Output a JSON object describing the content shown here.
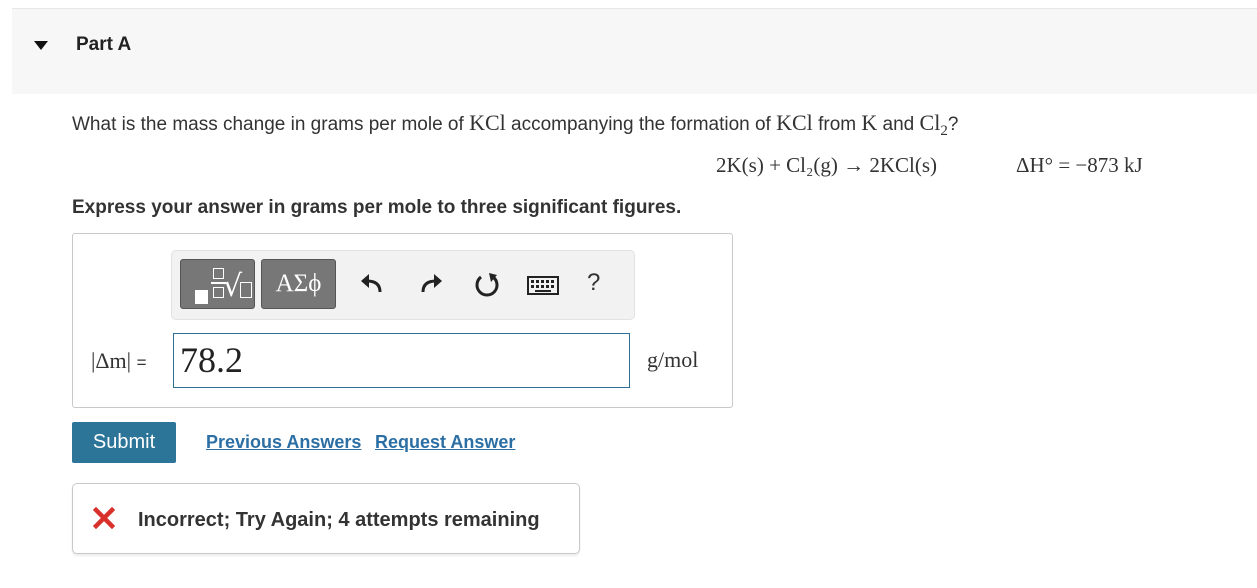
{
  "header": {
    "title": "Part A"
  },
  "question": {
    "pre": "What is the mass change in grams per mole of ",
    "compound": "KCl",
    "mid1": " accompanying the formation of ",
    "compound2": "KCl",
    "mid2": " from ",
    "element1": "K",
    "mid3": " and ",
    "element2": "Cl",
    "element2_sub": "2",
    "post": "?"
  },
  "equation": {
    "reaction": "2K(s) + Cl₂(g) → 2KCl(s)",
    "enthalpy": "ΔH° = −873 kJ"
  },
  "instruction": "Express your answer in grams per mole to three significant figures.",
  "toolbar": {
    "greek_label": "ΑΣϕ",
    "help_label": "?"
  },
  "answer": {
    "label": "|Δm|",
    "equals": "=",
    "value": "78.2",
    "unit": "g/mol"
  },
  "actions": {
    "submit": "Submit",
    "previous": "Previous Answers",
    "request": "Request Answer"
  },
  "feedback": {
    "message": "Incorrect; Try Again; 4 attempts remaining",
    "color": "#d9302b"
  },
  "colors": {
    "accent": "#2c7498",
    "link": "#2c6fa4",
    "input_border": "#2d6f96"
  },
  "icons": [
    "collapse-triangle-icon",
    "undo-icon",
    "redo-icon",
    "reset-icon",
    "keyboard-icon",
    "incorrect-x-icon"
  ]
}
